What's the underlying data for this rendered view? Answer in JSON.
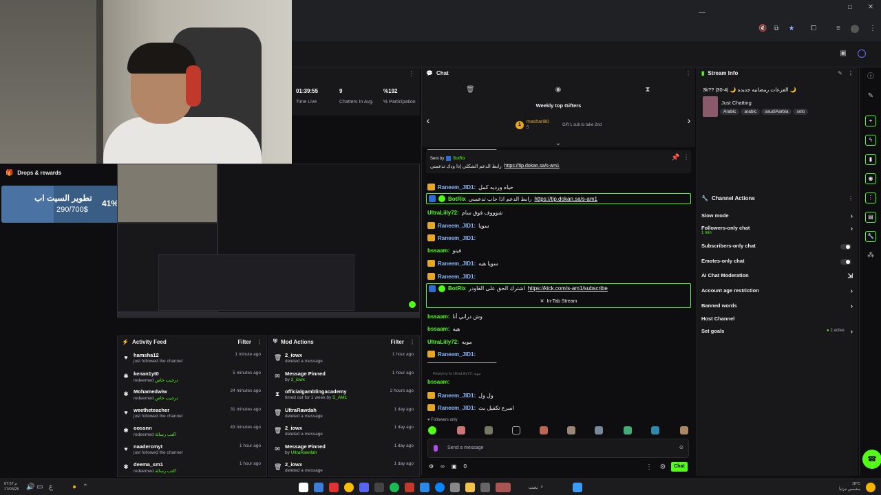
{
  "stats": {
    "time_live_value": "01:39:55",
    "time_live_label": "Time Live",
    "chatters_value": "9",
    "chatters_label": "Chatters In Avg.",
    "participation_value": "%192",
    "participation_label": "% Participation"
  },
  "drops": {
    "title": "Drops & rewards",
    "reward_name": "تطوير السيت اب",
    "reward_progress_text": "290/700$",
    "reward_percent": "41%",
    "reward_fraction": 0.41
  },
  "activity_feed": {
    "title": "Activity Feed",
    "filter_label": "Filter",
    "items": [
      {
        "icon": "heart-icon",
        "name": "hamsha12",
        "sub": "just followed the channel",
        "highlight": "",
        "time": "1 minute ago"
      },
      {
        "icon": "reward-icon",
        "name": "kenan1yt0",
        "sub": "redeemed ",
        "highlight": "ترحيب خاص",
        "time": "5 minutes ago"
      },
      {
        "icon": "reward-icon",
        "name": "Mohamedwiw",
        "sub": "redeemed ",
        "highlight": "ترحيب خاص",
        "time": "24 minutes ago"
      },
      {
        "icon": "heart-icon",
        "name": "weetheteacher",
        "sub": "just followed the channel",
        "highlight": "",
        "time": "31 minutes ago"
      },
      {
        "icon": "reward-icon",
        "name": "oossnn",
        "sub": "redeemed ",
        "highlight": "اكتب رسالة",
        "time": "43 minutes ago"
      },
      {
        "icon": "heart-icon",
        "name": "naadercmyt",
        "sub": "just followed the channel",
        "highlight": "",
        "time": "1 hour ago"
      },
      {
        "icon": "reward-icon",
        "name": "deema_sm1",
        "sub": "redeemed ",
        "highlight": "اكتب رسالة",
        "time": "1 hour ago"
      }
    ]
  },
  "mod_actions": {
    "title": "Mod Actions",
    "filter_label": "Filter",
    "items": [
      {
        "icon": "trash-icon",
        "name": "2_iowx",
        "sub": "deleted a message",
        "highlight": "",
        "time": "1 hour ago"
      },
      {
        "icon": "pin-icon",
        "name": "Message Pinned",
        "sub": "by ",
        "highlight": "2_iowx",
        "time": "1 hour ago"
      },
      {
        "icon": "hourglass-icon",
        "name": "officialgamblingacademy",
        "sub": "timed out for 1 week by ",
        "highlight": "S_AM1",
        "time": "2 hours ago"
      },
      {
        "icon": "trash-icon",
        "name": "UltraRawdah",
        "sub": "deleted a message",
        "highlight": "",
        "time": "1 day ago"
      },
      {
        "icon": "trash-icon",
        "name": "2_iowx",
        "sub": "deleted a message",
        "highlight": "",
        "time": "1 day ago"
      },
      {
        "icon": "pin-icon",
        "name": "Message Pinned",
        "sub": "by ",
        "highlight": "UltraRawdah",
        "time": "1 day ago"
      },
      {
        "icon": "trash-icon",
        "name": "2_iowx",
        "sub": "deleted a message",
        "highlight": "",
        "time": "1 day ago"
      }
    ]
  },
  "chat": {
    "title": "Chat",
    "gifters_title": "Weekly top Gifters",
    "gifter_name": "mashari80",
    "gifter_rank": "1",
    "gifter_count": "5",
    "gift_hint": "Gift 1 sub to take 2nd",
    "divider_text": "ـــــــــــــــــــــــــــــــــــــــــــــــــــــــــ",
    "pinned_sent_by": "Sent by",
    "pinned_bot": "BotRix",
    "pinned_text": "رابط الدعم الشكلي إذا ودك تدعمني",
    "pinned_link": "https://tip.dokan.sa/s-am1",
    "messages": [
      {
        "type": "user",
        "color": "blue",
        "crown": true,
        "name": "Raneem_JID1:",
        "text": "حياه ورديه كمل"
      },
      {
        "type": "bot",
        "name": "BotRix",
        "text": "رابط الدعم اذا حاب تدعمني",
        "link": "https://tip.dokan.sa/s-am1"
      },
      {
        "type": "user",
        "color": "green",
        "crown": false,
        "name": "UltraLiily72:",
        "text": "شوووف فوق سام"
      },
      {
        "type": "user",
        "color": "blue",
        "crown": true,
        "name": "Raneem_JID1:",
        "text": "سويا"
      },
      {
        "type": "user",
        "color": "blue",
        "crown": true,
        "name": "Raneem_JID1:",
        "text": ""
      },
      {
        "type": "user",
        "color": "green",
        "crown": false,
        "name": "bssaam:",
        "text": "فيتو"
      },
      {
        "type": "user",
        "color": "blue",
        "crown": true,
        "name": "Raneem_JID1:",
        "text": "سويا هيه"
      },
      {
        "type": "user",
        "color": "blue",
        "crown": true,
        "name": "Raneem_JID1:",
        "text": ""
      },
      {
        "type": "bot",
        "name": "BotRix",
        "text": "اشترك الحق على القاودر",
        "link": "https://kick.com/s-am1/subscribe"
      },
      {
        "type": "user",
        "color": "green",
        "crown": false,
        "name": "bssaam:",
        "text": "وش دراني أنا"
      },
      {
        "type": "user",
        "color": "green",
        "crown": false,
        "name": "bssaam:",
        "text": "هيه"
      },
      {
        "type": "user",
        "color": "green",
        "crown": false,
        "name": "UltraLiily72:",
        "text": "مويه"
      },
      {
        "type": "user",
        "color": "blue",
        "crown": true,
        "name": "Raneem_JID1:",
        "text": ""
      },
      {
        "type": "user",
        "color": "green",
        "crown": false,
        "name": "bssaam:",
        "text": ""
      },
      {
        "type": "user",
        "color": "blue",
        "crown": true,
        "name": "Raneem_JID1:",
        "text": "ول ول"
      },
      {
        "type": "user",
        "color": "blue",
        "crown": true,
        "name": "Raneem_JID1:",
        "text": "اسرع تكفيل بث"
      }
    ],
    "in_tab_stream": "In-Tab Stream",
    "replying_to": "Replying to UltraLiily72: مويه",
    "followers_only": "Followers only",
    "input_placeholder": "Send a message",
    "points": "0",
    "chat_button": "Chat",
    "infinity": "∞"
  },
  "stream_info": {
    "title": "Stream Info",
    "stream_title": "3k?? |30-4| 🌙 الفزعات رمضانيه جديده 🌙",
    "category": "Just Chatting",
    "tags": [
      "Arabic",
      "arabic",
      "saudiAarbia",
      "solo"
    ]
  },
  "channel_actions": {
    "title": "Channel Actions",
    "slow_mode": "Slow mode",
    "followers_only_chat": "Followers-only chat",
    "followers_only_value": "1 min",
    "subscribers_only_chat": "Subscribers-only chat",
    "emotes_only_chat": "Emotes-only chat",
    "ai_chat_moderation": "AI Chat Moderation",
    "account_age_restriction": "Account age restriction",
    "banned_words": "Banned words",
    "host_channel": "Host Channel",
    "set_goals": "Set goals",
    "set_goals_status": "2 active"
  },
  "taskbar": {
    "search_label": "بحث",
    "temperature": "18°C",
    "weather": "مشمس جزئياً",
    "time": "07:57 م",
    "date": "17/03/25"
  },
  "colors": {
    "kick_green": "#53fc18",
    "background": "#0e0e10",
    "panel": "#18181b",
    "drops_box": "#3a5d86",
    "username_blue": "#8ab4f8",
    "crown": "#e5a823"
  }
}
